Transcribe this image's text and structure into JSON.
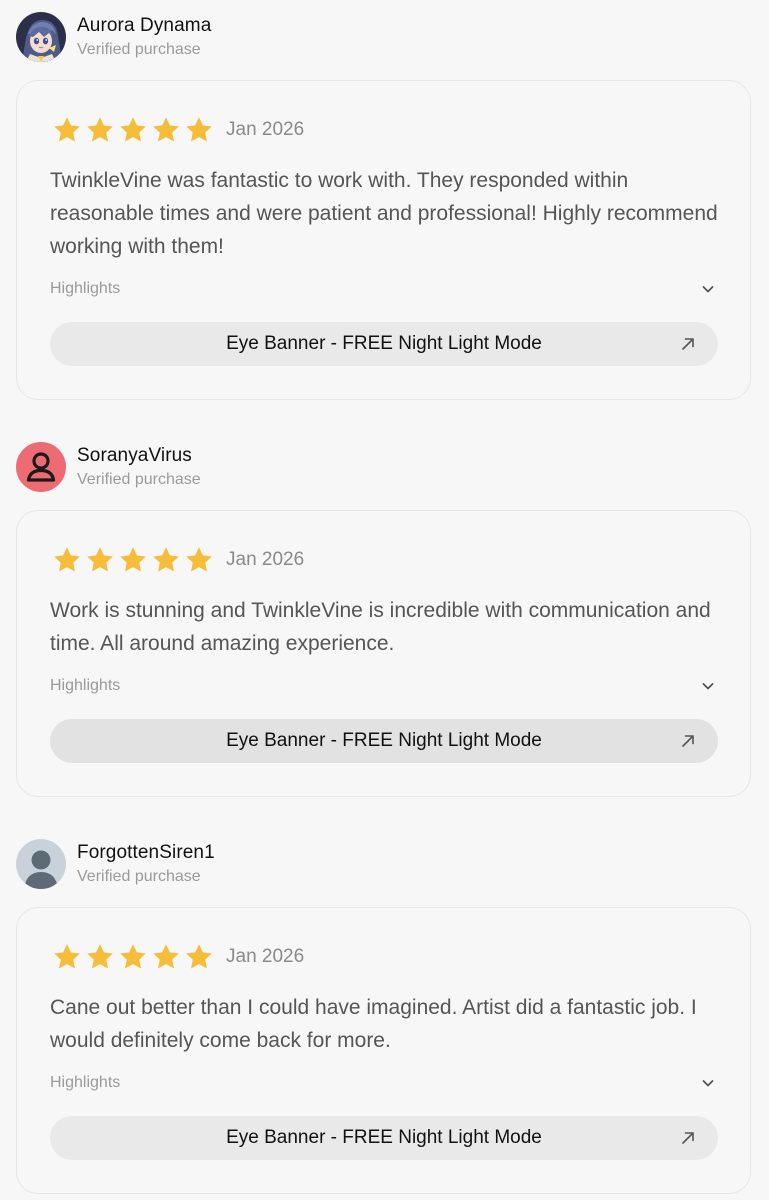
{
  "colors": {
    "star": "#f6bd3b",
    "background": "#f7f7f7",
    "button": "#e9e9e9"
  },
  "reviews": [
    {
      "reviewer": "Aurora Dynama",
      "avatar": "anime-character-avatar",
      "verified": "Verified purchase",
      "rating": 5,
      "date": "Jan 2026",
      "text": "TwinkleVine was fantastic to work with. They responded within reasonable times and were patient and professional! Highly recommend working with them!",
      "highlights_label": "Highlights",
      "product": "Eye Banner - FREE Night Light Mode"
    },
    {
      "reviewer": "SoranyaVirus",
      "avatar": "person-outline-icon",
      "verified": "Verified purchase",
      "rating": 5,
      "date": "Jan 2026",
      "text": "Work is stunning and TwinkleVine is incredible with communication and time. All around amazing experience.",
      "highlights_label": "Highlights",
      "product": "Eye Banner - FREE Night Light Mode"
    },
    {
      "reviewer": "ForgottenSiren1",
      "avatar": "default-user-silhouette",
      "verified": "Verified purchase",
      "rating": 5,
      "date": "Jan 2026",
      "text": "Cane out better than I could have imagined. Artist did a fantastic job. I would definitely come back for more.",
      "highlights_label": "Highlights",
      "product": "Eye Banner - FREE Night Light Mode"
    }
  ]
}
